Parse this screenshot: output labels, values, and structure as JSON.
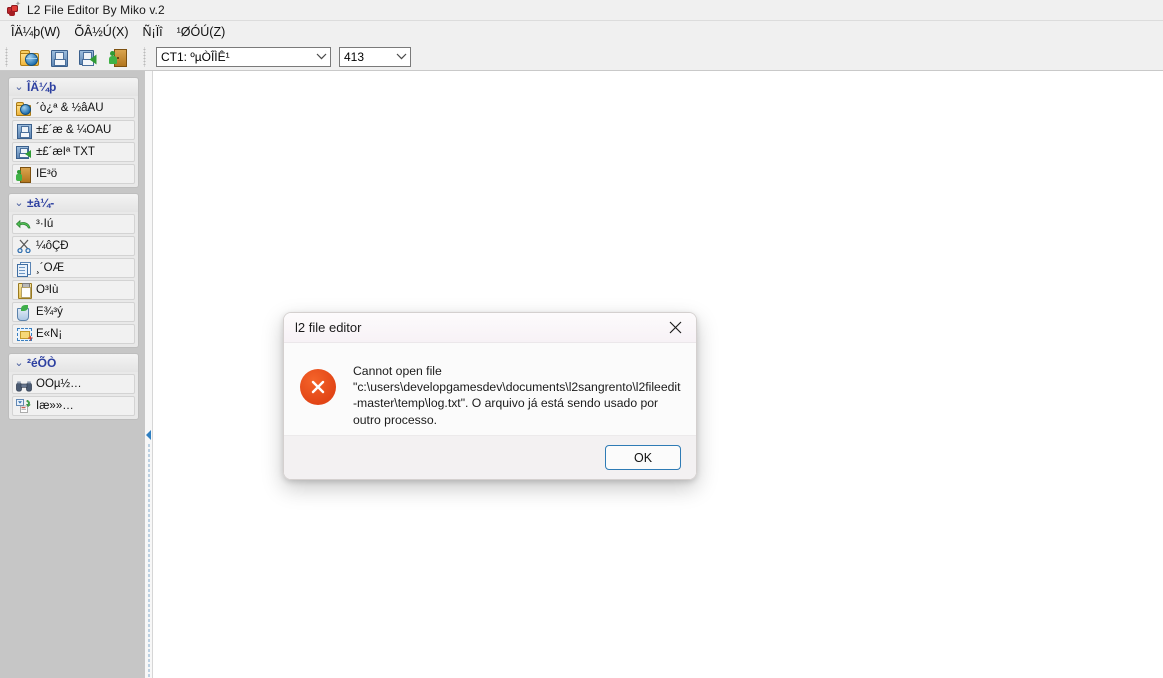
{
  "window": {
    "title": "L2 File Editor By Miko v.2",
    "icon": "app-icon"
  },
  "menubar": {
    "items": [
      {
        "label": "ÎÄ¼þ(W)",
        "name": "menu-file"
      },
      {
        "label": "ÕÂ½Ú(X)",
        "name": "menu-chapter"
      },
      {
        "label": "Ñ¡Ïî",
        "name": "menu-options"
      },
      {
        "label": "¹ØÓÚ(Z)",
        "name": "menu-about"
      }
    ]
  },
  "toolbar": {
    "buttons": [
      {
        "name": "open-file-button",
        "icon": "folder-globe-icon"
      },
      {
        "name": "save-file-button",
        "icon": "floppy-icon"
      },
      {
        "name": "save-txt-button",
        "icon": "floppy-export-icon"
      },
      {
        "name": "exit-button",
        "icon": "exit-door-icon"
      }
    ],
    "chapter_combo": {
      "value": "CT1: ºµÒÎÌÊ¹",
      "options": [
        "CT1: ºµÒÎÌÊ¹"
      ]
    },
    "line_combo": {
      "value": "413",
      "options": [
        "413"
      ]
    }
  },
  "sidebar": {
    "groups": [
      {
        "name": "group-file",
        "title": "ÎÄ¼þ",
        "items": [
          {
            "label": "´ò¿ª & ½âÃÜ",
            "icon": "folder-globe-icon",
            "name": "sidebar-item-open-decrypt"
          },
          {
            "label": "±£´æ & ¼ÓÃÜ",
            "icon": "floppy-icon",
            "name": "sidebar-item-save-encrypt"
          },
          {
            "label": "±£´æÎª TXT",
            "icon": "floppy-export-icon",
            "name": "sidebar-item-save-as-txt"
          },
          {
            "label": "ÍË³ö",
            "icon": "exit-door-icon",
            "name": "sidebar-item-exit"
          }
        ]
      },
      {
        "name": "group-edit",
        "title": "±à¼-",
        "items": [
          {
            "label": "³·Ïú",
            "icon": "undo-icon",
            "name": "sidebar-item-undo"
          },
          {
            "label": "¼ôÇÐ",
            "icon": "scissors-icon",
            "name": "sidebar-item-cut"
          },
          {
            "label": "¸´ÖÆ",
            "icon": "copy-icon",
            "name": "sidebar-item-copy"
          },
          {
            "label": "Õ³Ìù",
            "icon": "paste-icon",
            "name": "sidebar-item-paste"
          },
          {
            "label": "É¾³ý",
            "icon": "paste-special-icon",
            "name": "sidebar-item-delete"
          },
          {
            "label": "È«Ñ¡",
            "icon": "select-all-icon",
            "name": "sidebar-item-select-all"
          }
        ]
      },
      {
        "name": "group-search",
        "title": "²éÕÒ",
        "items": [
          {
            "label": "ÕÒµ½…",
            "icon": "binoculars-icon",
            "name": "sidebar-item-find"
          },
          {
            "label": "Ìæ»»…",
            "icon": "replace-icon",
            "name": "sidebar-item-replace"
          }
        ]
      }
    ]
  },
  "dialog": {
    "title": "l2 file editor",
    "close_icon": "close-icon",
    "error_icon": "error-circle-x-icon",
    "message_line1": "Cannot open file",
    "message_line2": "\"c:\\users\\developgamesdev\\documents\\l2sangrento\\l2fileedit-master\\temp\\log.txt\". O arquivo já está sendo usado por outro processo.",
    "ok_label": "OK"
  },
  "colors": {
    "accent_blue": "#2c3fa0",
    "error_orange": "#e24516",
    "titlebar_bg": "#f0f0f0",
    "sidebar_bg": "#c6c6c6",
    "dialog_bg": "#fbfbfb",
    "button_focus_border": "#2e7bb5"
  }
}
